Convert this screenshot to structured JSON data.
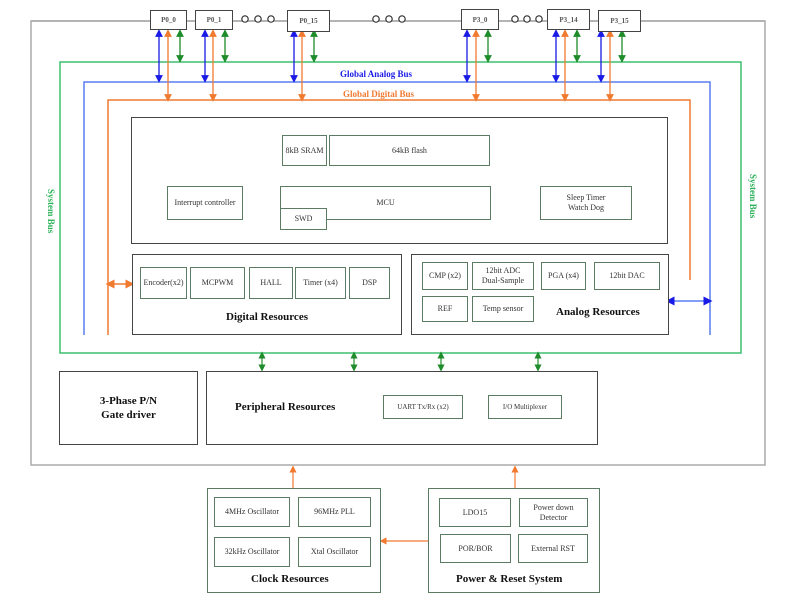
{
  "diagram": {
    "colors": {
      "system_bus": "#3fbf6f",
      "analog_bus": "#5a7df0",
      "digital_bus": "#f07a30",
      "frame": "#aaaaaa",
      "block_border": "#5b7b63",
      "analog_label": "#1a1ae6",
      "digital_label": "#f07a30",
      "system_label": "#2db25a"
    },
    "pins": [
      "P0_0",
      "P0_1",
      "P0_15",
      "P3_0",
      "P3_14",
      "P3_15"
    ],
    "ellipsis": "o o o",
    "buses": {
      "analog": "Global Analog Bus",
      "digital": "Global Digital Bus",
      "system_left": "System Bus",
      "system_right": "System Bus"
    },
    "core": {
      "sram": "8kB SRAM",
      "flash": "64kB flash",
      "interrupt": "Interrupt controller",
      "mcu": "MCU",
      "swd": "SWD",
      "sleep_line1": "Sleep Timer",
      "sleep_line2": "Watch Dog"
    },
    "digital": {
      "title": "Digital Resources",
      "items": [
        "Encoder(x2)",
        "MCPWM",
        "HALL",
        "Timer (x4)",
        "DSP"
      ]
    },
    "analog": {
      "title": "Analog Resources",
      "cmp": "CMP (x2)",
      "adc_line1": "12bit ADC",
      "adc_line2": "Dual-Sample",
      "pga": "PGA (x4)",
      "dac": "12bit DAC",
      "ref": "REF",
      "temp": "Temp sensor"
    },
    "gate_driver": {
      "line1": "3-Phase P/N",
      "line2": "Gate driver"
    },
    "peripheral": {
      "title": "Peripheral Resources",
      "uart": "UART Tx/Rx (x2)",
      "iomux": "I/O Multiplexer"
    },
    "clock": {
      "title": "Clock Resources",
      "items": [
        "4MHz Oscillator",
        "96MHz PLL",
        "32kHz Oscillator",
        "Xtal Oscillator"
      ]
    },
    "power": {
      "title": "Power & Reset System",
      "ldo": "LDO15",
      "pdd_line1": "Power down",
      "pdd_line2": "Detector",
      "por": "POR/BOR",
      "rst": "External RST"
    }
  }
}
